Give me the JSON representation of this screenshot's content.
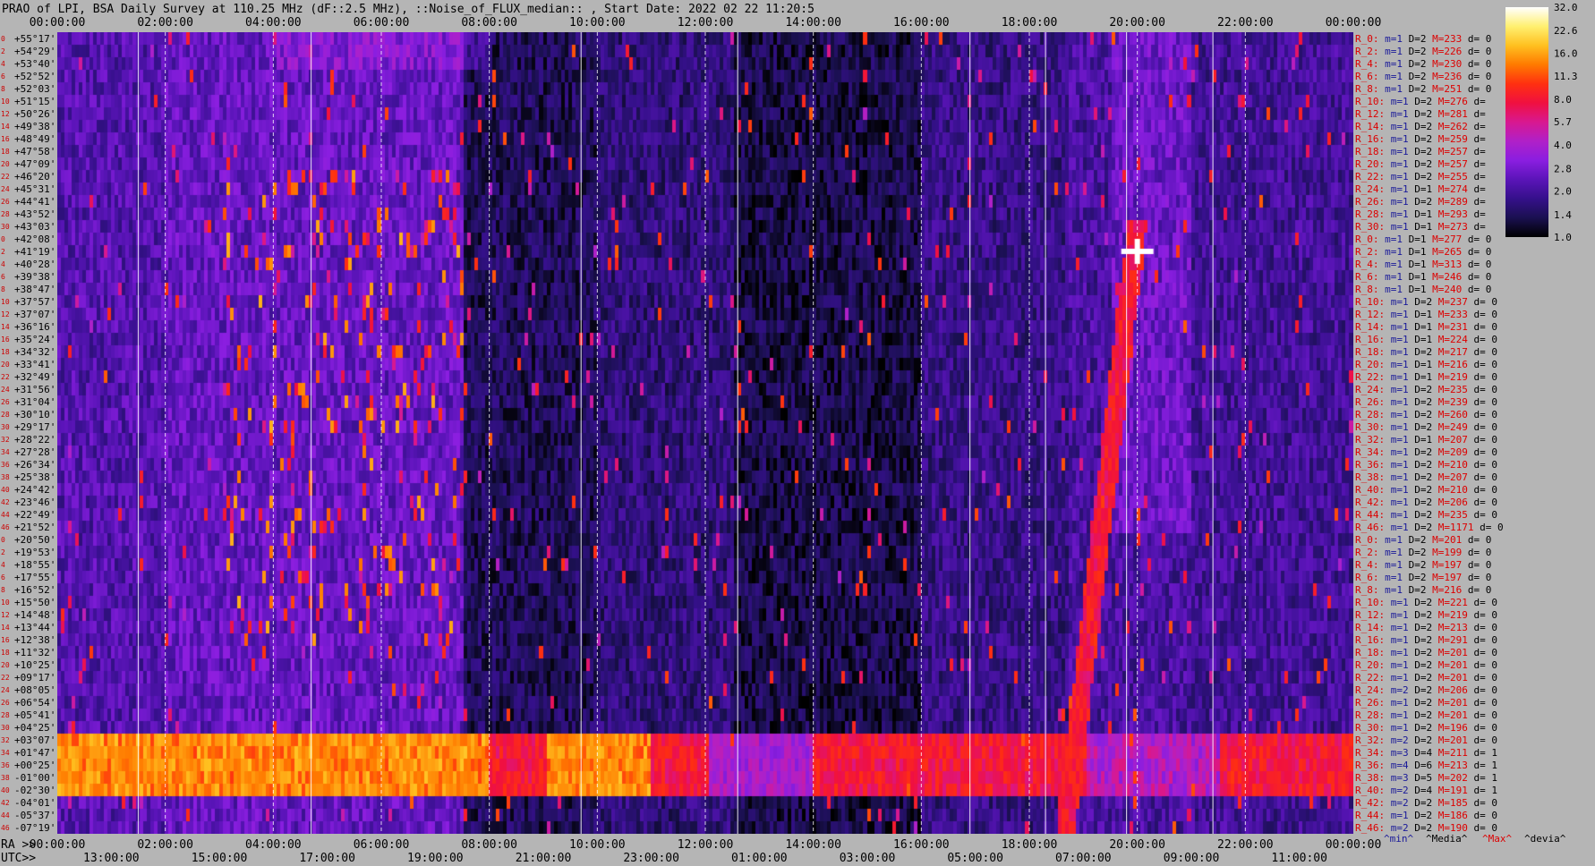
{
  "title": "PRAO of LPI, BSA Daily Survey at 110.25 MHz (dF::2.5 MHz), ::Noise_of_FLUX_median:: , Start Date: 2022 02 22 11:20:5",
  "chart_data": {
    "type": "heatmap",
    "x_top_ticks": [
      "00:00:00",
      "02:00:00",
      "04:00:00",
      "06:00:00",
      "08:00:00",
      "10:00:00",
      "12:00:00",
      "14:00:00",
      "16:00:00",
      "18:00:00",
      "20:00:00",
      "22:00:00",
      "00:00:00"
    ],
    "ra_label": "RA >>",
    "ra_ticks": [
      "00:00:00",
      "02:00:00",
      "04:00:00",
      "06:00:00",
      "08:00:00",
      "10:00:00",
      "12:00:00",
      "14:00:00",
      "16:00:00",
      "18:00:00",
      "20:00:00",
      "22:00:00",
      "00:00:00"
    ],
    "utc_label": "UTC>>",
    "utc_ticks": [
      "13:00:00",
      "15:00:00",
      "17:00:00",
      "19:00:00",
      "21:00:00",
      "23:00:00",
      "01:00:00",
      "03:00:00",
      "05:00:00",
      "07:00:00",
      "09:00:00",
      "11:00:00"
    ],
    "dec_labels": [
      "+55°17'",
      "+54°29'",
      "+53°40'",
      "+52°52'",
      "+52°03'",
      "+51°15'",
      "+50°26'",
      "+49°38'",
      "+48°49'",
      "+47°58'",
      "+47°09'",
      "+46°20'",
      "+45°31'",
      "+44°41'",
      "+43°52'",
      "+43°03'",
      "+42°08'",
      "+41°19'",
      "+40°28'",
      "+39°38'",
      "+38°47'",
      "+37°57'",
      "+37°07'",
      "+36°16'",
      "+35°24'",
      "+34°32'",
      "+33°41'",
      "+32°49'",
      "+31°56'",
      "+31°04'",
      "+30°10'",
      "+29°17'",
      "+28°22'",
      "+27°28'",
      "+26°34'",
      "+25°38'",
      "+24°42'",
      "+23°46'",
      "+22°49'",
      "+21°52'",
      "+20°50'",
      "+19°53'",
      "+18°55'",
      "+17°55'",
      "+16°52'",
      "+15°50'",
      "+14°48'",
      "+13°44'",
      "+12°38'",
      "+11°32'",
      "+10°25'",
      "+09°17'",
      "+08°05'",
      "+06°54'",
      "+05°41'",
      "+04°25'",
      "+03°07'",
      "+01°47'",
      "+00°25'",
      "-01°00'",
      "-02°30'",
      "-04°01'",
      "-05°37'",
      "-07°19'"
    ],
    "row_index_labels": [
      "0",
      "2",
      "4",
      "6",
      "8",
      "10",
      "12",
      "14",
      "16",
      "18",
      "20",
      "22",
      "24",
      "26",
      "28",
      "30",
      "0",
      "2",
      "4",
      "6",
      "8",
      "10",
      "12",
      "14",
      "16",
      "18",
      "20",
      "22",
      "24",
      "26",
      "28",
      "30",
      "32",
      "34",
      "36",
      "38",
      "40",
      "42",
      "44",
      "46",
      "0",
      "2",
      "4",
      "6",
      "8",
      "10",
      "12",
      "14",
      "16",
      "18",
      "20",
      "22",
      "24",
      "26",
      "28",
      "30",
      "32",
      "34",
      "36",
      "38",
      "40",
      "42",
      "44",
      "46"
    ],
    "beam_stats": [
      {
        "r": "R_0:",
        "m": "m=1",
        "D": "D=2",
        "M": "M=233",
        "d": "d= 0"
      },
      {
        "r": "R_2:",
        "m": "m=1",
        "D": "D=2",
        "M": "M=226",
        "d": "d= 0"
      },
      {
        "r": "R_4:",
        "m": "m=1",
        "D": "D=2",
        "M": "M=230",
        "d": "d= 0"
      },
      {
        "r": "R_6:",
        "m": "m=1",
        "D": "D=2",
        "M": "M=236",
        "d": "d= 0"
      },
      {
        "r": "R_8:",
        "m": "m=1",
        "D": "D=2",
        "M": "M=251",
        "d": "d= 0"
      },
      {
        "r": "R_10:",
        "m": "m=1",
        "D": "D=2",
        "M": "M=276",
        "d": "d="
      },
      {
        "r": "R_12:",
        "m": "m=1",
        "D": "D=2",
        "M": "M=281",
        "d": "d="
      },
      {
        "r": "R_14:",
        "m": "m=1",
        "D": "D=2",
        "M": "M=262",
        "d": "d="
      },
      {
        "r": "R_16:",
        "m": "m=1",
        "D": "D=2",
        "M": "M=259",
        "d": "d="
      },
      {
        "r": "R_18:",
        "m": "m=1",
        "D": "D=2",
        "M": "M=257",
        "d": "d="
      },
      {
        "r": "R_20:",
        "m": "m=1",
        "D": "D=2",
        "M": "M=257",
        "d": "d="
      },
      {
        "r": "R_22:",
        "m": "m=1",
        "D": "D=2",
        "M": "M=255",
        "d": "d="
      },
      {
        "r": "R_24:",
        "m": "m=1",
        "D": "D=1",
        "M": "M=274",
        "d": "d="
      },
      {
        "r": "R_26:",
        "m": "m=1",
        "D": "D=2",
        "M": "M=289",
        "d": "d="
      },
      {
        "r": "R_28:",
        "m": "m=1",
        "D": "D=1",
        "M": "M=293",
        "d": "d="
      },
      {
        "r": "R_30:",
        "m": "m=1",
        "D": "D=1",
        "M": "M=273",
        "d": "d="
      },
      {
        "r": "R_0:",
        "m": "m=1",
        "D": "D=1",
        "M": "M=277",
        "d": "d= 0"
      },
      {
        "r": "R_2:",
        "m": "m=1",
        "D": "D=1",
        "M": "M=265",
        "d": "d= 0"
      },
      {
        "r": "R_4:",
        "m": "m=1",
        "D": "D=1",
        "M": "M=313",
        "d": "d= 0"
      },
      {
        "r": "R_6:",
        "m": "m=1",
        "D": "D=1",
        "M": "M=246",
        "d": "d= 0"
      },
      {
        "r": "R_8:",
        "m": "m=1",
        "D": "D=1",
        "M": "M=240",
        "d": "d= 0"
      },
      {
        "r": "R_10:",
        "m": "m=1",
        "D": "D=2",
        "M": "M=237",
        "d": "d= 0"
      },
      {
        "r": "R_12:",
        "m": "m=1",
        "D": "D=1",
        "M": "M=233",
        "d": "d= 0"
      },
      {
        "r": "R_14:",
        "m": "m=1",
        "D": "D=1",
        "M": "M=231",
        "d": "d= 0"
      },
      {
        "r": "R_16:",
        "m": "m=1",
        "D": "D=1",
        "M": "M=224",
        "d": "d= 0"
      },
      {
        "r": "R_18:",
        "m": "m=1",
        "D": "D=2",
        "M": "M=217",
        "d": "d= 0"
      },
      {
        "r": "R_20:",
        "m": "m=1",
        "D": "D=1",
        "M": "M=216",
        "d": "d= 0"
      },
      {
        "r": "R_22:",
        "m": "m=1",
        "D": "D=1",
        "M": "M=219",
        "d": "d= 0"
      },
      {
        "r": "R_24:",
        "m": "m=1",
        "D": "D=2",
        "M": "M=235",
        "d": "d= 0"
      },
      {
        "r": "R_26:",
        "m": "m=1",
        "D": "D=2",
        "M": "M=239",
        "d": "d= 0"
      },
      {
        "r": "R_28:",
        "m": "m=1",
        "D": "D=2",
        "M": "M=260",
        "d": "d= 0"
      },
      {
        "r": "R_30:",
        "m": "m=1",
        "D": "D=2",
        "M": "M=249",
        "d": "d= 0"
      },
      {
        "r": "R_32:",
        "m": "m=1",
        "D": "D=1",
        "M": "M=207",
        "d": "d= 0"
      },
      {
        "r": "R_34:",
        "m": "m=1",
        "D": "D=2",
        "M": "M=209",
        "d": "d= 0"
      },
      {
        "r": "R_36:",
        "m": "m=1",
        "D": "D=2",
        "M": "M=210",
        "d": "d= 0"
      },
      {
        "r": "R_38:",
        "m": "m=1",
        "D": "D=2",
        "M": "M=207",
        "d": "d= 0"
      },
      {
        "r": "R_40:",
        "m": "m=1",
        "D": "D=2",
        "M": "M=210",
        "d": "d= 0"
      },
      {
        "r": "R_42:",
        "m": "m=1",
        "D": "D=2",
        "M": "M=206",
        "d": "d= 0"
      },
      {
        "r": "R_44:",
        "m": "m=1",
        "D": "D=2",
        "M": "M=235",
        "d": "d= 0"
      },
      {
        "r": "R_46:",
        "m": "m=1",
        "D": "D=2",
        "M": "M=1171",
        "d": "d= 0"
      },
      {
        "r": "R_0:",
        "m": "m=1",
        "D": "D=2",
        "M": "M=201",
        "d": "d= 0"
      },
      {
        "r": "R_2:",
        "m": "m=1",
        "D": "D=2",
        "M": "M=199",
        "d": "d= 0"
      },
      {
        "r": "R_4:",
        "m": "m=1",
        "D": "D=2",
        "M": "M=197",
        "d": "d= 0"
      },
      {
        "r": "R_6:",
        "m": "m=1",
        "D": "D=2",
        "M": "M=197",
        "d": "d= 0"
      },
      {
        "r": "R_8:",
        "m": "m=1",
        "D": "D=2",
        "M": "M=216",
        "d": "d= 0"
      },
      {
        "r": "R_10:",
        "m": "m=1",
        "D": "D=2",
        "M": "M=221",
        "d": "d= 0"
      },
      {
        "r": "R_12:",
        "m": "m=1",
        "D": "D=2",
        "M": "M=219",
        "d": "d= 0"
      },
      {
        "r": "R_14:",
        "m": "m=1",
        "D": "D=2",
        "M": "M=213",
        "d": "d= 0"
      },
      {
        "r": "R_16:",
        "m": "m=1",
        "D": "D=2",
        "M": "M=291",
        "d": "d= 0"
      },
      {
        "r": "R_18:",
        "m": "m=1",
        "D": "D=2",
        "M": "M=201",
        "d": "d= 0"
      },
      {
        "r": "R_20:",
        "m": "m=1",
        "D": "D=2",
        "M": "M=201",
        "d": "d= 0"
      },
      {
        "r": "R_22:",
        "m": "m=1",
        "D": "D=2",
        "M": "M=201",
        "d": "d= 0"
      },
      {
        "r": "R_24:",
        "m": "m=2",
        "D": "D=2",
        "M": "M=206",
        "d": "d= 0"
      },
      {
        "r": "R_26:",
        "m": "m=1",
        "D": "D=2",
        "M": "M=201",
        "d": "d= 0"
      },
      {
        "r": "R_28:",
        "m": "m=1",
        "D": "D=2",
        "M": "M=201",
        "d": "d= 0"
      },
      {
        "r": "R_30:",
        "m": "m=1",
        "D": "D=2",
        "M": "M=196",
        "d": "d= 0"
      },
      {
        "r": "R_32:",
        "m": "m=2",
        "D": "D=2",
        "M": "M=201",
        "d": "d= 0"
      },
      {
        "r": "R_34:",
        "m": "m=3",
        "D": "D=4",
        "M": "M=211",
        "d": "d= 1"
      },
      {
        "r": "R_36:",
        "m": "m=4",
        "D": "D=6",
        "M": "M=213",
        "d": "d= 1"
      },
      {
        "r": "R_38:",
        "m": "m=3",
        "D": "D=5",
        "M": "M=202",
        "d": "d= 1"
      },
      {
        "r": "R_40:",
        "m": "m=2",
        "D": "D=4",
        "M": "M=191",
        "d": "d= 1"
      },
      {
        "r": "R_42:",
        "m": "m=2",
        "D": "D=2",
        "M": "M=185",
        "d": "d= 0"
      },
      {
        "r": "R_44:",
        "m": "m=1",
        "D": "D=2",
        "M": "M=186",
        "d": "d= 0"
      },
      {
        "r": "R_46:",
        "m": "m=2",
        "D": "D=2",
        "M": "M=190",
        "d": "d= 0"
      }
    ],
    "footer_legend": [
      "^min^",
      "^Media^",
      "^Max^",
      "^devia^"
    ],
    "colorbar": {
      "ticks": [
        "32.0",
        "22.6",
        "16.0",
        "11.3",
        "8.0",
        "5.7",
        "4.0",
        "2.8",
        "2.0",
        "1.4",
        "1.0"
      ],
      "range": [
        1.0,
        32.0
      ],
      "scale": "log",
      "palette": [
        "#000000",
        "#1a1050",
        "#35108a",
        "#5a14b8",
        "#8a1ee0",
        "#b020c8",
        "#d81890",
        "#f01040",
        "#ff3010",
        "#ff7a00",
        "#ffc020",
        "#fff070",
        "#ffffff"
      ]
    },
    "features": [
      {
        "name": "horizontal-band",
        "dec": [
          "+03°07'",
          "-02°30'"
        ],
        "ra": [
          "00:00:00",
          "24:00:00"
        ],
        "level": 9.0
      },
      {
        "name": "sloped-trail",
        "ra": [
          "20:00:00",
          "18:40:00"
        ],
        "dec": [
          "+40°28'",
          "-07°19'"
        ],
        "level": 7.0
      },
      {
        "name": "bright-source",
        "ra": "20:00:00",
        "dec": "+41°19'",
        "level": 32.0
      },
      {
        "name": "active-region",
        "ra": [
          "03:00:00",
          "08:00:00"
        ],
        "dec": [
          "+46°20'",
          "+11°32'"
        ],
        "level": 5.0
      }
    ],
    "xlabel": "",
    "ylabel": ""
  }
}
